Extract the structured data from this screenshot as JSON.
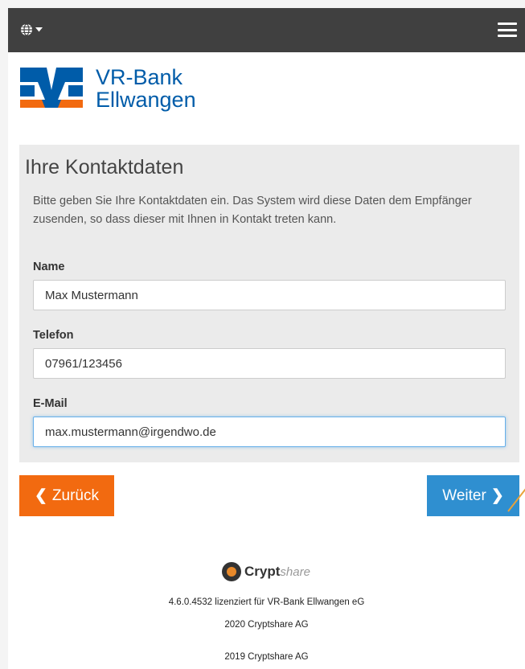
{
  "header": {
    "language_icon": "globe-icon",
    "caret_icon": "caret-down-icon",
    "menu_icon": "hamburger-menu-icon"
  },
  "brand": {
    "name_line1": "VR-Bank",
    "name_line2": "Ellwangen",
    "colors": {
      "blue": "#005ca9",
      "orange": "#f26a10"
    }
  },
  "form": {
    "title": "Ihre Kontaktdaten",
    "description": "Bitte geben Sie Ihre Kontaktdaten ein. Das System wird diese Daten dem Empfänger zusenden, so dass dieser mit Ihnen in Kontakt treten kann.",
    "name_label": "Name",
    "name_value": "Max Mustermann",
    "phone_label": "Telefon",
    "phone_value": "07961/123456",
    "email_label": "E-Mail",
    "email_value": "max.mustermann@irgendwo.de"
  },
  "buttons": {
    "back_label": "Zurück",
    "back_icon": "chevron-left-icon",
    "next_label": "Weiter",
    "next_icon": "chevron-right-icon",
    "back_color": "#f26a10",
    "next_color": "#2f8fd0"
  },
  "footer": {
    "logo_main": "Crypt",
    "logo_suffix": "share",
    "license": "4.6.0.4532 lizenziert für VR-Bank Ellwangen eG",
    "copyright1": "2020 Cryptshare AG",
    "copyright2": "2019 Cryptshare AG"
  }
}
